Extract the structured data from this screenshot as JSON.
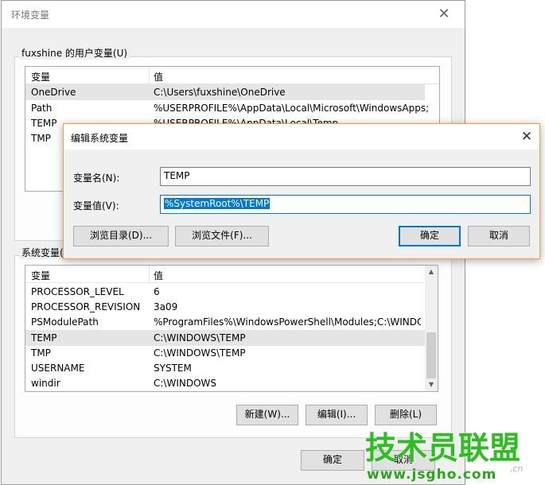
{
  "parent": {
    "title": "环境变量",
    "close_glyph": "✕",
    "user_group_label": "fuxshine 的用户变量(U)",
    "system_group_label": "系统变量(S)",
    "columns": {
      "name": "变量",
      "value": "值"
    },
    "user_vars": [
      {
        "name": "OneDrive",
        "value": "C:\\Users\\fuxshine\\OneDrive"
      },
      {
        "name": "Path",
        "value": "%USERPROFILE%\\AppData\\Local\\Microsoft\\WindowsApps;"
      },
      {
        "name": "TEMP",
        "value": "%USERPROFILE%\\AppData\\Local\\Temp"
      },
      {
        "name": "TMP",
        "value": ""
      }
    ],
    "system_vars": [
      {
        "name": "PROCESSOR_LEVEL",
        "value": "6"
      },
      {
        "name": "PROCESSOR_REVISION",
        "value": "3a09"
      },
      {
        "name": "PSModulePath",
        "value": "%ProgramFiles%\\WindowsPowerShell\\Modules;C:\\WINDOW..."
      },
      {
        "name": "TEMP",
        "value": "C:\\WINDOWS\\TEMP"
      },
      {
        "name": "TMP",
        "value": "C:\\WINDOWS\\TEMP"
      },
      {
        "name": "USERNAME",
        "value": "SYSTEM"
      },
      {
        "name": "windir",
        "value": "C:\\WINDOWS"
      }
    ],
    "system_buttons": {
      "new": "新建(W)...",
      "edit": "编辑(I)...",
      "delete": "删除(L)"
    },
    "ok_label": "确定",
    "cancel_label": "取消"
  },
  "dialog": {
    "title": "编辑系统变量",
    "close_glyph": "✕",
    "name_label": "变量名(N):",
    "name_value": "TEMP",
    "value_label": "变量值(V):",
    "value_value": "%SystemRoot%\\TEMP",
    "browse_dir": "浏览目录(D)...",
    "browse_file": "浏览文件(F)...",
    "ok": "确定",
    "cancel": "取消"
  },
  "scroll": {
    "up_glyph": "▲",
    "down_glyph": "▼"
  },
  "watermark": {
    "title": "技术员联盟",
    "url": "www.jsgho.com",
    "suffix": ".cn"
  },
  "colors": {
    "accent": "#0078d7",
    "dialog_border": "#f0a040",
    "watermark": "#2dbf1f"
  }
}
